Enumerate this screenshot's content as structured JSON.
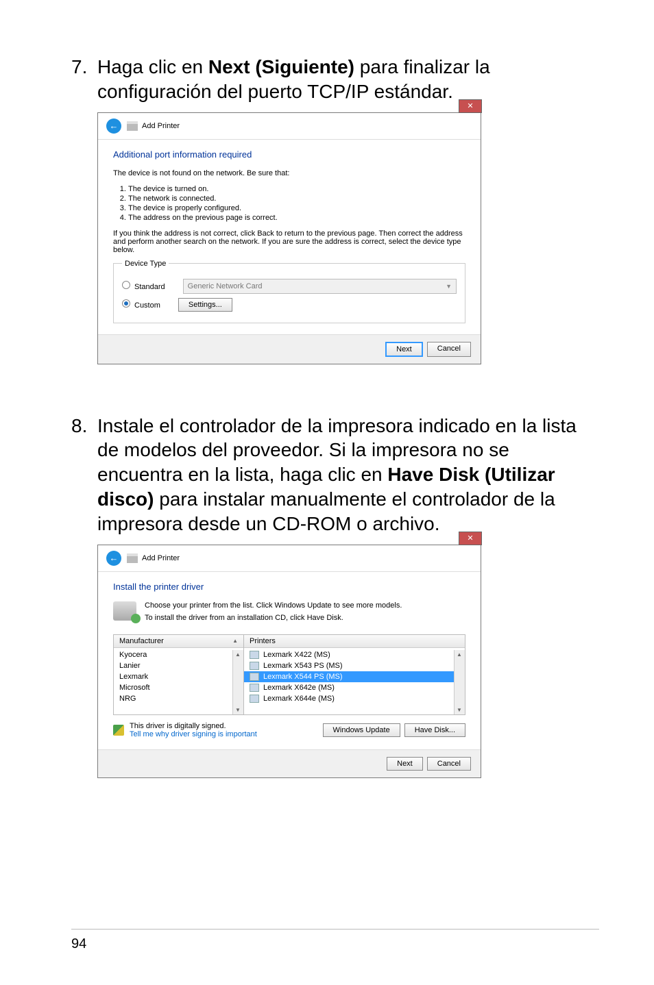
{
  "step7": {
    "num": "7.",
    "text_before": "Haga clic en ",
    "bold": "Next (Siguiente)",
    "text_after": " para finalizar la configuración del puerto TCP/IP estándar."
  },
  "dialog1": {
    "close": "✕",
    "header": "Add Printer",
    "section_title": "Additional port information required",
    "info_line": "The device is not found on the network. Be sure that:",
    "bullets": [
      "The device is turned on.",
      "The network is connected.",
      "The device is properly configured.",
      "The address on the previous page is correct."
    ],
    "paragraph": "If you think the address is not correct, click Back to return to the previous page. Then correct the address and perform another search on the network. If you are sure the address is correct, select the device type below.",
    "fieldset_legend": "Device Type",
    "radio_standard": "Standard",
    "combo_value": "Generic Network Card",
    "radio_custom": "Custom",
    "settings_btn": "Settings...",
    "next_btn": "Next",
    "cancel_btn": "Cancel"
  },
  "step8": {
    "num": "8.",
    "text_before": "Instale el controlador de la impresora indicado en la lista de modelos del proveedor. Si la impresora no se encuentra en la lista, haga clic en ",
    "bold": "Have Disk (Utilizar disco)",
    "text_after": " para instalar manualmente el controlador de la impresora desde un CD-ROM o archivo."
  },
  "dialog2": {
    "close": "✕",
    "header": "Add Printer",
    "section_title": "Install the printer driver",
    "choose_line1": "Choose your printer from the list. Click Windows Update to see more models.",
    "choose_line2": "To install the driver from an installation CD, click Have Disk.",
    "manufacturer_header": "Manufacturer",
    "printers_header": "Printers",
    "manufacturers": [
      "Kyocera",
      "Lanier",
      "Lexmark",
      "Microsoft",
      "NRG"
    ],
    "printers": [
      {
        "label": "Lexmark X422 (MS)",
        "selected": false
      },
      {
        "label": "Lexmark X543 PS (MS)",
        "selected": false
      },
      {
        "label": "Lexmark X544 PS (MS)",
        "selected": true
      },
      {
        "label": "Lexmark X642e (MS)",
        "selected": false
      },
      {
        "label": "Lexmark X644e (MS)",
        "selected": false
      }
    ],
    "signed_text": "This driver is digitally signed.",
    "signed_link": "Tell me why driver signing is important",
    "windows_update_btn": "Windows Update",
    "have_disk_btn": "Have Disk...",
    "next_btn": "Next",
    "cancel_btn": "Cancel"
  },
  "page_number": "94"
}
